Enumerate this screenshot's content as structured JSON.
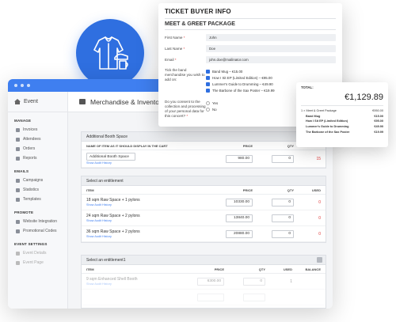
{
  "sidebar": {
    "event_label": "Event",
    "sections": [
      {
        "title": "MANAGE",
        "items": [
          "Invoices",
          "Attendees",
          "Orders",
          "Reports"
        ]
      },
      {
        "title": "EMAILS",
        "items": [
          "Campaigns",
          "Statistics",
          "Templates"
        ]
      },
      {
        "title": "PROMOTE",
        "items": [
          "Website Integration",
          "Promotional Codes"
        ]
      },
      {
        "title": "EVENT SETTINGS",
        "items": [
          "Event Details",
          "Event Page"
        ]
      }
    ]
  },
  "main": {
    "title": "Merchandise & Inventory",
    "booth_panel": {
      "header": "Additional Booth Space",
      "columns": [
        "NAME OF ITEM AS IT SHOULD DISPLAY IN THE CART",
        "PRICE",
        "QTY",
        "USED"
      ],
      "row": {
        "name": "Additional Booth Space",
        "link": "Show Audit History",
        "price": "980.00",
        "qty": "0",
        "used": "15"
      }
    },
    "entitlement_panel": {
      "header": "Select an entitlement",
      "columns": [
        "ITEM",
        "PRICE",
        "QTY",
        "USED"
      ],
      "rows": [
        {
          "item": "18 sqm Raw Space + 1 pylons",
          "link": "Show Audit History",
          "price": "10330.00",
          "qty": "0",
          "used": "0"
        },
        {
          "item": "24 sqm Raw Space + 2 pylons",
          "link": "Show Audit History",
          "price": "13840.00",
          "qty": "0",
          "used": "0"
        },
        {
          "item": "36 sqm Raw Space + 2 pylons",
          "link": "Show Audit History",
          "price": "20880.00",
          "qty": "0",
          "used": "0"
        }
      ]
    },
    "entitlement1_panel": {
      "header": "Select an entitlement1",
      "columns": [
        "ITEM",
        "PRICE",
        "QTY",
        "USED",
        "BALANCE"
      ],
      "rows": [
        {
          "item": "9 sqm Enhanced Shell Booth",
          "link": "Show Audit History",
          "price": "6300.00",
          "qty": "0",
          "used": "1",
          "balance": ""
        },
        {
          "item": "",
          "link": "",
          "price": "",
          "qty": "",
          "used": "",
          "balance": ""
        }
      ]
    }
  },
  "ticket": {
    "title": "TICKET BUYER INFO",
    "subtitle": "MEET & GREET PACKAGE",
    "fields": [
      {
        "label": "First Name",
        "required": "*",
        "value": "John"
      },
      {
        "label": "Last Name",
        "required": "*",
        "value": "Doe"
      },
      {
        "label": "Email",
        "required": "*",
        "value": "john.doe@mailinator.com"
      }
    ],
    "merch_question": "Tick the band merchandise you wish to add on:",
    "merch_options": [
      "Band Mug – €15.00",
      "How I Sit EP (Limited Edition) – €95.00",
      "Lummer's Guide to Drumming – €49.90",
      "The Barbone of the Sax Poster – €19.99"
    ],
    "consent_question": "Do you consent to the collection and processing of your personal data for this concert?",
    "consent_required": "*",
    "consent_options": [
      "Yes",
      "No"
    ]
  },
  "total": {
    "label": "TOTAL:",
    "amount": "€1,129.89",
    "lines": [
      {
        "name": "1 × Meet & Greet Package",
        "price": "€950.00"
      },
      {
        "name": "Band Mug",
        "price": "€15.00"
      },
      {
        "name": "How I Sit EP (Limited Edition)",
        "price": "€95.00"
      },
      {
        "name": "Lummer's Guide to Drumming",
        "price": "€49.90"
      },
      {
        "name": "The Barbone of the Sax Poster",
        "price": "€19.99"
      }
    ]
  },
  "colors": {
    "accent": "#3f7ff0",
    "circle": "#2f6fe0",
    "danger": "#e03a3a"
  }
}
